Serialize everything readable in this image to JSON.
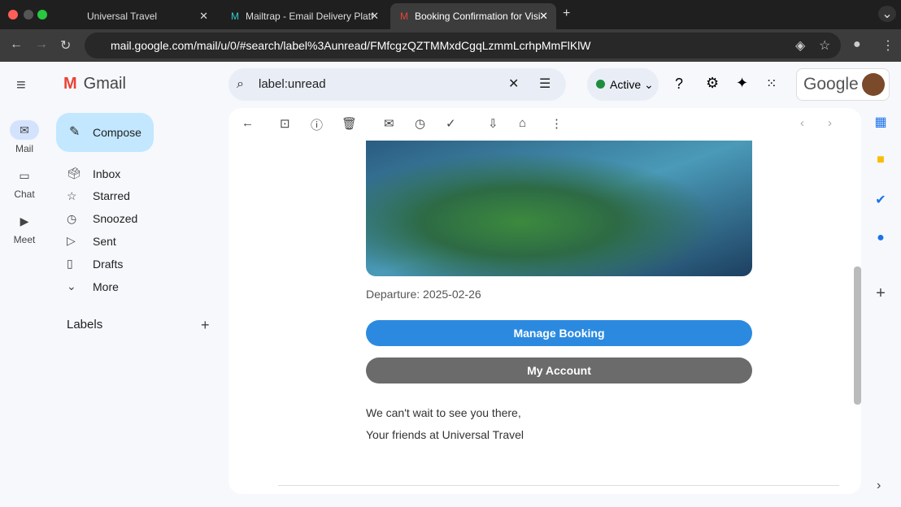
{
  "browser": {
    "tabs": [
      {
        "title": "Universal Travel"
      },
      {
        "title": "Mailtrap - Email Delivery Platf"
      },
      {
        "title": "Booking Confirmation for Visi"
      }
    ],
    "url": "mail.google.com/mail/u/0/#search/label%3Aunread/FMfcgzQZTMMxdCgqLzmmLcrhpMmFlKlW"
  },
  "gmail": {
    "logo": "Gmail",
    "rail": [
      {
        "label": "Mail"
      },
      {
        "label": "Chat"
      },
      {
        "label": "Meet"
      }
    ],
    "compose": "Compose",
    "nav": [
      {
        "label": "Inbox",
        "icon": "inbox-icon",
        "g": "🗳"
      },
      {
        "label": "Starred",
        "icon": "star-icon",
        "g": "☆"
      },
      {
        "label": "Snoozed",
        "icon": "clock-icon",
        "g": "◷"
      },
      {
        "label": "Sent",
        "icon": "send-icon",
        "g": "▷"
      },
      {
        "label": "Drafts",
        "icon": "draft-icon",
        "g": "▯"
      },
      {
        "label": "More",
        "icon": "chevron-down-icon",
        "g": "⌄"
      }
    ],
    "labels_title": "Labels",
    "search": "label:unread",
    "status": "Active",
    "google": "Google"
  },
  "email": {
    "departure": "Departure: 2025-02-26",
    "manage": "Manage Booking",
    "account": "My Account",
    "closing": "We can't wait to see you there,",
    "signature": "Your friends at Universal Travel"
  },
  "colors": {
    "manage": "#2b8ae0",
    "account": "#6b6b6b"
  }
}
